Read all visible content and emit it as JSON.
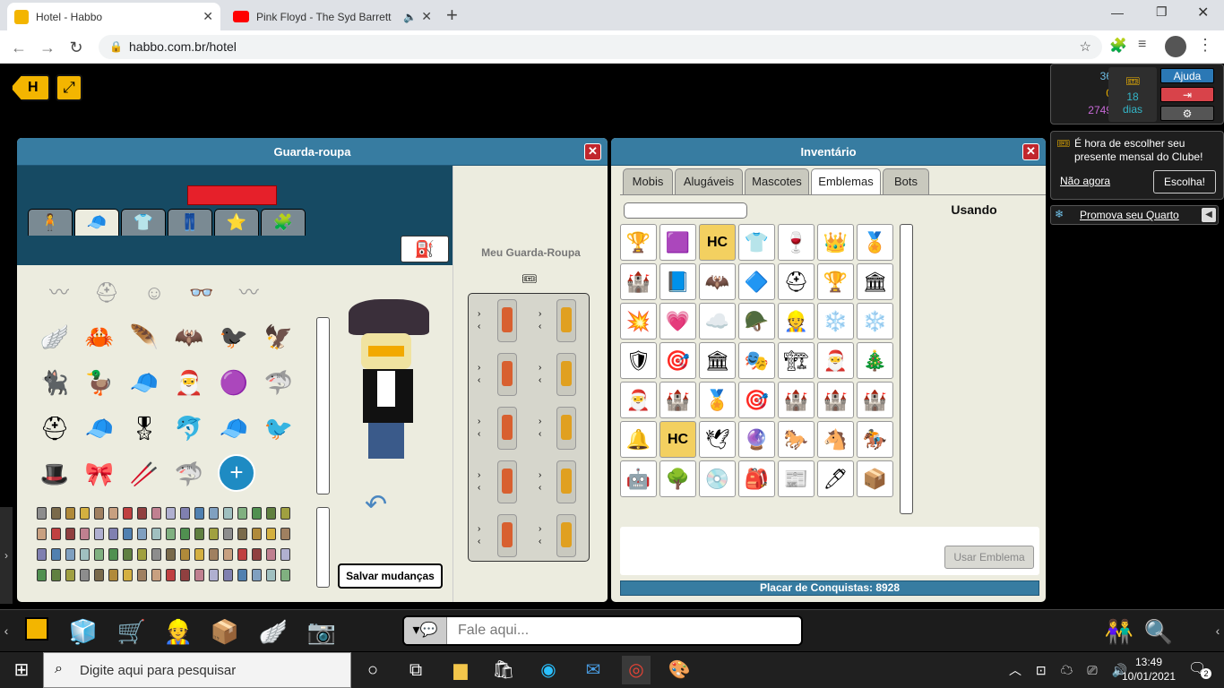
{
  "browser": {
    "tabs": [
      {
        "title": "Hotel - Habbo",
        "active": true
      },
      {
        "title": "Pink Floyd - The Syd Barrett",
        "active": false
      }
    ],
    "url": "habbo.com.br/hotel"
  },
  "wardrobe": {
    "title": "Guarda-roupa",
    "my_wardrobe_label": "Meu Guarda-Roupa",
    "save_label": "Salvar mudanças",
    "categories": [
      "body",
      "head",
      "torso",
      "legs",
      "favorites",
      "groups"
    ],
    "items": [
      "🪽",
      "🦀",
      "🪶",
      "🦇",
      "🐦‍⬛",
      "🦅",
      "🐈‍⬛",
      "🦆",
      "🧢",
      "🎅",
      "🟣",
      "🦈",
      "⛑",
      "🧢",
      "🎖",
      "🐬",
      "🧢",
      "🐦",
      "🎩",
      "🎀",
      "🥢",
      "🦈"
    ],
    "add_icon": "plus-icon"
  },
  "inventory": {
    "title": "Inventário",
    "tabs": [
      "Mobis",
      "Alugáveis",
      "Mascotes",
      "Emblemas",
      "Bots"
    ],
    "active_tab": "Emblemas",
    "in_use_label": "Usando",
    "use_badge_label": "Usar Emblema",
    "achievement_score_label": "Placar de Conquistas: 8928",
    "badges": [
      "🏆",
      "🟪",
      "HC",
      "👕",
      "🍷",
      "👑",
      "🏅",
      "🏰",
      "📘",
      "🦇",
      "🔷",
      "⛑",
      "🏆",
      "🏛",
      "💥",
      "💗",
      "☁️",
      "🪖",
      "👷",
      "❄️",
      "❄️",
      "🛡",
      "🎯",
      "🏛",
      "🎭",
      "🏗",
      "🎅",
      "🎄",
      "🎅",
      "🏰",
      "🏅",
      "🎯",
      "🏰",
      "🏰",
      "🏰",
      "🔔",
      "HC",
      "🕊",
      "🔮",
      "🐎",
      "🐴",
      "🏇",
      "🤖",
      "🌳",
      "💿",
      "🎒",
      "📰",
      "🖊",
      "📦"
    ],
    "search_placeholder": ""
  },
  "hud": {
    "diamonds": "36",
    "credits": "0",
    "duckets": "2749",
    "club_days": "18",
    "club_days_label": "dias",
    "help_label": "Ajuda"
  },
  "notification": {
    "text": "É hora de escolher seu presente mensal do Clube!",
    "dismiss_label": "Não agora",
    "choose_label": "Escolha!"
  },
  "promo": {
    "label": "Promova seu Quarto"
  },
  "chat": {
    "placeholder": "Fale aqui..."
  },
  "taskbar": {
    "search_placeholder": "Digite aqui para pesquisar",
    "time": "13:49",
    "date": "10/01/2021",
    "notifications": "2"
  },
  "colors": {
    "window_header": "#377ca1",
    "habbo_yellow": "#f3b500",
    "close_red": "#c1272d"
  }
}
